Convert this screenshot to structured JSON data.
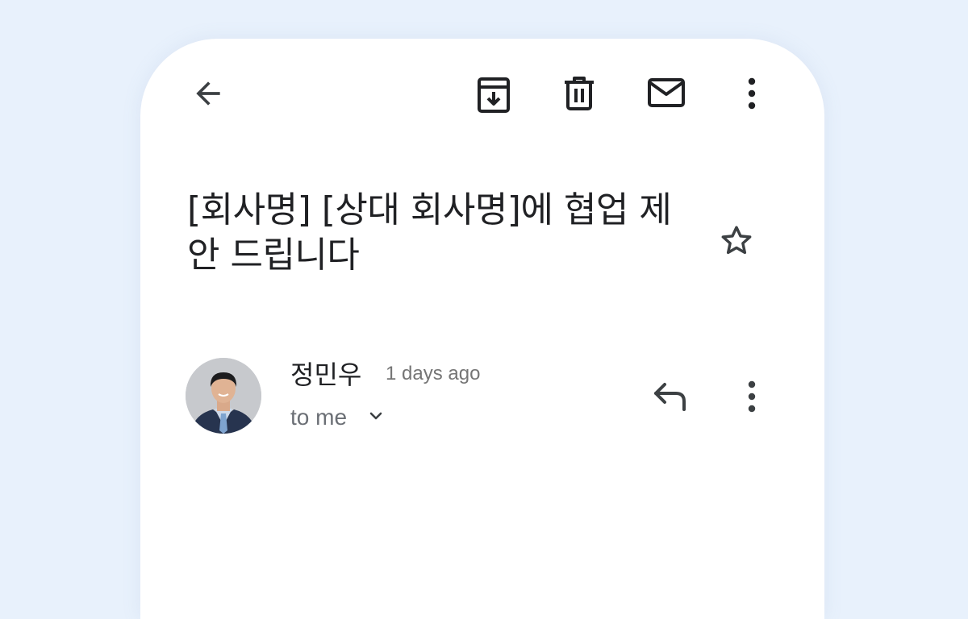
{
  "email": {
    "subject": "[회사명] [상대 회사명]에 협업 제안 드립니다",
    "sender_name": "정민우",
    "time_ago": "1 days ago",
    "recipient": "to me"
  },
  "toolbar": {
    "icons": [
      "back-arrow-icon",
      "archive-icon",
      "delete-icon",
      "mail-icon",
      "more-vert-icon"
    ]
  },
  "message_actions": {
    "icons": [
      "star-icon",
      "reply-icon",
      "more-vert-icon",
      "chevron-down-icon"
    ]
  },
  "colors": {
    "background": "#e8f1fc",
    "card": "#ffffff",
    "text": "#202124",
    "icon": "#3c4043",
    "secondary_text": "#6b6f75"
  }
}
